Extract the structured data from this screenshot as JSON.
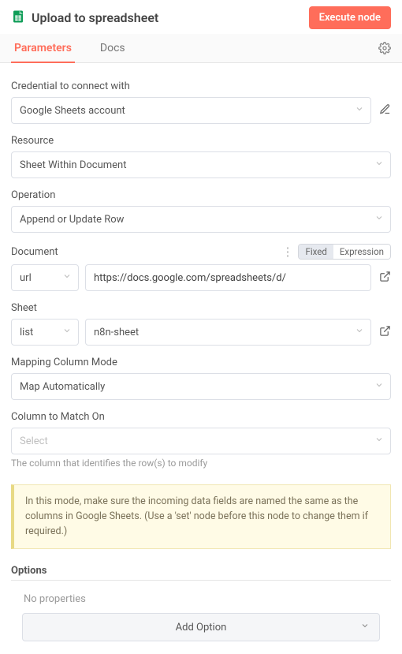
{
  "header": {
    "title": "Upload to spreadsheet",
    "execute_label": "Execute node"
  },
  "tabs": {
    "parameters": "Parameters",
    "docs": "Docs"
  },
  "fields": {
    "credential": {
      "label": "Credential to connect with",
      "value": "Google Sheets account"
    },
    "resource": {
      "label": "Resource",
      "value": "Sheet Within Document"
    },
    "operation": {
      "label": "Operation",
      "value": "Append or Update Row"
    },
    "document": {
      "label": "Document",
      "mode_fixed": "Fixed",
      "mode_expression": "Expression",
      "mode_selected": "Fixed",
      "sub_mode": "url",
      "value": "https://docs.google.com/spreadsheets/d/"
    },
    "sheet": {
      "label": "Sheet",
      "sub_mode": "list",
      "value": "n8n-sheet"
    },
    "mapping_mode": {
      "label": "Mapping Column Mode",
      "value": "Map Automatically"
    },
    "column_match": {
      "label": "Column to Match On",
      "placeholder": "Select",
      "helper": "The column that identifies the row(s) to modify"
    }
  },
  "info_note": "In this mode, make sure the incoming data fields are named the same as the columns in Google Sheets. (Use a 'set' node before this node to change them if required.)",
  "options": {
    "title": "Options",
    "empty": "No properties",
    "add_label": "Add Option"
  }
}
